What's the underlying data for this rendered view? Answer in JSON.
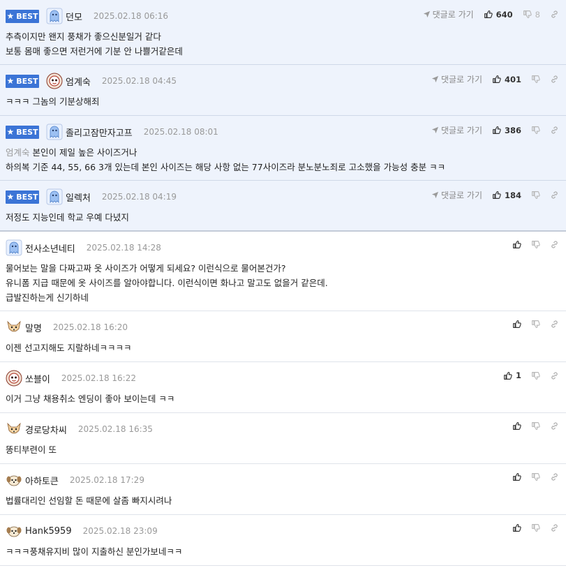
{
  "labels": {
    "best": "BEST",
    "goto": "댓글로 가기"
  },
  "colors": {
    "best_bg": "#eef3fc",
    "badge": "#3b74d6",
    "mention": "#999999"
  },
  "comments": [
    {
      "best": true,
      "avatar": "blue-ghost",
      "nick": "던모",
      "date": "2025.02.18 06:16",
      "show_goto": true,
      "up": "640",
      "down": "8",
      "lines": [
        {
          "mention": "",
          "text": "추측이지만 왠지 풍채가 좋으신분일거 같다"
        },
        {
          "mention": "",
          "text": "보통 몸매 좋으면 저런거에 기분 안 나쁠거같은데"
        }
      ]
    },
    {
      "best": true,
      "avatar": "red-mask",
      "nick": "엄계숙",
      "date": "2025.02.18 04:45",
      "show_goto": true,
      "up": "401",
      "down": "",
      "lines": [
        {
          "mention": "",
          "text": "ㅋㅋㅋ 그놈의 기분상해죄"
        }
      ]
    },
    {
      "best": true,
      "avatar": "blue-ghost",
      "nick": "졸리고잠만자고프",
      "date": "2025.02.18 08:01",
      "show_goto": true,
      "up": "386",
      "down": "",
      "lines": [
        {
          "mention": "엄계숙",
          "text": "본인이 제일 높은 사이즈거나"
        },
        {
          "mention": "",
          "text": "하의복 기준 44, 55, 66 3개 있는데 본인 사이즈는 해당 사항 없는 77사이즈라 분노분노죄로 고소했을 가능성 충분 ㅋㅋ"
        }
      ]
    },
    {
      "best": true,
      "avatar": "blue-ghost",
      "nick": "일렉처",
      "date": "2025.02.18 04:19",
      "show_goto": true,
      "up": "184",
      "down": "",
      "lines": [
        {
          "mention": "",
          "text": "저정도 지능인데 학교 우예 다녔지"
        }
      ]
    },
    {
      "best": false,
      "avatar": "blue-ghost",
      "nick": "전사소년네티",
      "date": "2025.02.18 14:28",
      "show_goto": false,
      "up": "",
      "down": "",
      "lines": [
        {
          "mention": "",
          "text": "물어보는 말을 다짜고짜 옷 사이즈가 어떻게 되세요? 이런식으로 물어본건가?"
        },
        {
          "mention": "",
          "text": "유니폼 지급 때문에 옷 사이즈를 알아야합니다. 이런식이면 화나고 말고도 없을거 같은데."
        },
        {
          "mention": "",
          "text": "급발진하는게 신기하네"
        }
      ]
    },
    {
      "best": false,
      "avatar": "fox",
      "nick": "말명",
      "date": "2025.02.18 16:20",
      "show_goto": false,
      "up": "",
      "down": "",
      "lines": [
        {
          "mention": "",
          "text": "이젠 선고지해도 지랄하네ㅋㅋㅋㅋ"
        }
      ]
    },
    {
      "best": false,
      "avatar": "red-mask",
      "nick": "쏘블이",
      "date": "2025.02.18 16:22",
      "show_goto": false,
      "up": "1",
      "down": "",
      "lines": [
        {
          "mention": "",
          "text": "이거 그냥 채용취소 엔딩이 좋아 보이는데 ㅋㅋ"
        }
      ]
    },
    {
      "best": false,
      "avatar": "fox",
      "nick": "경로당차씨",
      "date": "2025.02.18 16:35",
      "show_goto": false,
      "up": "",
      "down": "",
      "lines": [
        {
          "mention": "",
          "text": "똥티부련이 또"
        }
      ]
    },
    {
      "best": false,
      "avatar": "puppy",
      "nick": "아하토큰",
      "date": "2025.02.18 17:29",
      "show_goto": false,
      "up": "",
      "down": "",
      "lines": [
        {
          "mention": "",
          "text": "법률대리인 선임할 돈 때문에 살좀 빠지시려나"
        }
      ]
    },
    {
      "best": false,
      "avatar": "puppy",
      "nick": "Hank5959",
      "date": "2025.02.18 23:09",
      "show_goto": false,
      "up": "",
      "down": "",
      "lines": [
        {
          "mention": "",
          "text": "ㅋㅋㅋ풍채유지비 많이 지출하신 분인가보네ㅋㅋ"
        }
      ]
    }
  ]
}
